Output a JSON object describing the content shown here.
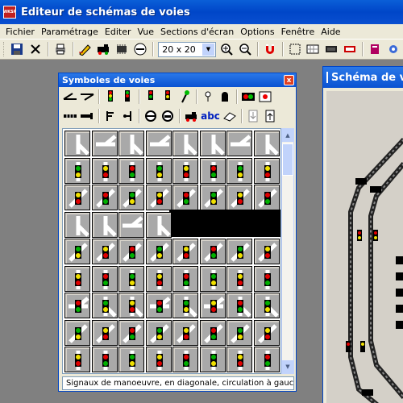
{
  "app": {
    "title": "Editeur de schémas de voies",
    "icon_label": "WKSP"
  },
  "menu": [
    "Fichier",
    "Paramétrage",
    "Editer",
    "Vue",
    "Sections d'écran",
    "Options",
    "Fenêtre",
    "Aide"
  ],
  "toolbar": {
    "grid_size": "20 x 20",
    "icons": [
      "save-icon",
      "delete-icon",
      "print-icon",
      "edit-pencil-icon",
      "locomotive-icon",
      "chip-icon",
      "no-entry-icon",
      "zoom-in-icon",
      "zoom-out-icon",
      "magnet-icon",
      "select-icon",
      "grid-icon",
      "module-icon",
      "sign-icon",
      "book-icon",
      "settings-icon"
    ]
  },
  "palette": {
    "title": "Symboles de voies",
    "close_label": "x",
    "row1_icons": [
      "switch-left-icon",
      "switch-right-icon",
      "signal-3-icon",
      "signal-3b-icon",
      "signal-2-icon",
      "signal-2b-icon",
      "signal-pole-icon",
      "bell-icon",
      "pedestrian-icon",
      "light-pair-icon",
      "stop-light-icon"
    ],
    "row2_icons": [
      "track-segment-icon",
      "buffer-icon",
      "signal-left-icon",
      "signal-right-icon",
      "cross-icon",
      "bumper-icon",
      "train-icon",
      "text-icon",
      "eraser-icon",
      "down-icon",
      "up-icon"
    ],
    "text_tool": "abc",
    "status": "Signaux de manoeuvre, en diagonale, circulation à gauche"
  },
  "diagram": {
    "title": "Schéma de voies"
  },
  "colors": {
    "accent": "#0a52d2",
    "signal_red": "#e00000",
    "signal_green": "#00b000",
    "signal_yellow": "#f0e000"
  }
}
